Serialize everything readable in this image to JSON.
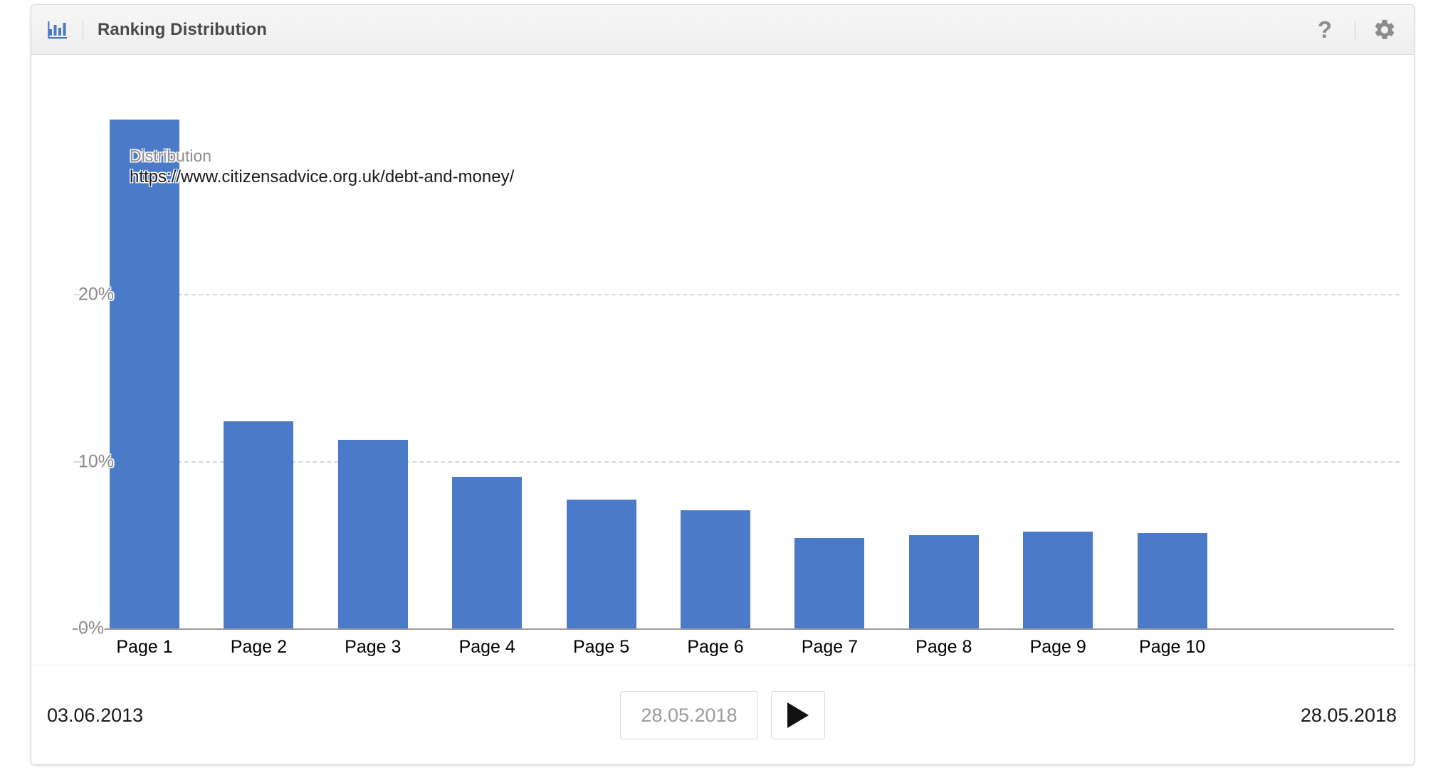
{
  "header": {
    "title": "Ranking Distribution",
    "chart_icon": "bar-chart-icon",
    "help_icon": "?",
    "help_icon_name": "help-icon",
    "settings_icon_name": "gear-icon"
  },
  "hover": {
    "series_label": "Distribution",
    "url": "https://www.citizensadvice.org.uk/debt-and-money/"
  },
  "slider": {
    "name": "date-range-slider",
    "thumb_position_percent": 100
  },
  "footer": {
    "start_date": "03.06.2013",
    "end_date": "28.05.2018",
    "current_date_value": "28.05.2018",
    "current_date_placeholder": "28.05.2018",
    "play_label": "▶"
  },
  "colors": {
    "bar": "#4a7ac8",
    "gridline": "#d8d8d8",
    "axis": "#9b9b9b",
    "title_text": "#4a4a4a",
    "tick_text": "#8a8a8a",
    "header_bg": "#eeeeee"
  },
  "chart_data": {
    "type": "bar",
    "title": "Ranking Distribution",
    "xlabel": "",
    "ylabel": "",
    "categories": [
      "Page 1",
      "Page 2",
      "Page 3",
      "Page 4",
      "Page 5",
      "Page 6",
      "Page 7",
      "Page 8",
      "Page 9",
      "Page 10"
    ],
    "values": [
      30.5,
      12.4,
      11.3,
      9.1,
      7.7,
      7.1,
      5.4,
      5.6,
      5.8,
      5.7
    ],
    "series": [
      {
        "name": "Distribution",
        "values": [
          30.5,
          12.4,
          11.3,
          9.1,
          7.7,
          7.1,
          5.4,
          5.6,
          5.8,
          5.7
        ]
      }
    ],
    "ylim": [
      0,
      30.5
    ],
    "yticks": [
      0,
      10,
      20
    ],
    "ytick_labels": [
      "0%",
      "10%",
      "20%"
    ],
    "grid": true,
    "legend": false,
    "legend_position": "none",
    "annotations": [
      {
        "text": "Distribution",
        "sub_text": "https://www.citizensadvice.org.uk/debt-and-money/",
        "attached_to": "Page 1"
      }
    ]
  }
}
